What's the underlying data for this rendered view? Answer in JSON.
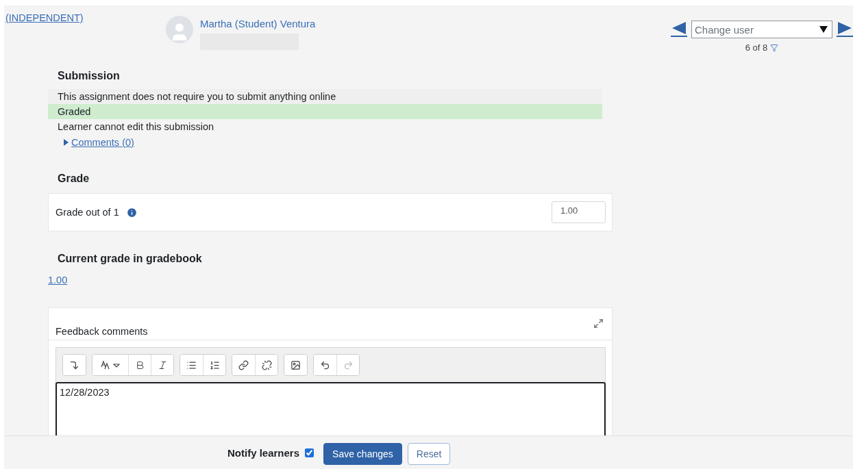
{
  "group_link": "(INDEPENDENT)",
  "user": {
    "name": "Martha (Student) Ventura"
  },
  "navigator": {
    "select": {
      "placeholder": "Change user"
    },
    "count": "6 of 8"
  },
  "submission": {
    "heading": "Submission",
    "statuses": [
      {
        "text": "This assignment does not require you to submit anything online",
        "kind": "neutral"
      },
      {
        "text": "Graded",
        "kind": "success"
      },
      {
        "text": "Learner cannot edit this submission",
        "kind": "plain"
      }
    ],
    "comments": {
      "label": "Comments (0)",
      "expanded": false
    }
  },
  "grade": {
    "heading": "Grade",
    "label": "Grade out of 1",
    "value": "1.00"
  },
  "gradebook": {
    "heading": "Current grade in gradebook",
    "value": "1.00"
  },
  "feedback": {
    "label": "Feedback comments",
    "toolbar": [
      [
        {
          "kind": "collapse",
          "disabled": false
        }
      ],
      [
        {
          "kind": "font",
          "disabled": false
        },
        {
          "kind": "bold",
          "disabled": false
        },
        {
          "kind": "italic",
          "disabled": false
        }
      ],
      [
        {
          "kind": "bullets",
          "disabled": false
        },
        {
          "kind": "numbers",
          "disabled": false
        }
      ],
      [
        {
          "kind": "link",
          "disabled": false
        },
        {
          "kind": "unlink",
          "disabled": false
        }
      ],
      [
        {
          "kind": "image",
          "disabled": false
        }
      ],
      [
        {
          "kind": "undo",
          "disabled": false
        },
        {
          "kind": "redo",
          "disabled": true
        }
      ]
    ],
    "text": "12/28/2023"
  },
  "footer": {
    "notify": {
      "label": "Notify learners",
      "checked": true
    },
    "buttons": [
      {
        "label": "Save changes",
        "kind": "primary"
      },
      {
        "label": "Reset",
        "kind": "secondary"
      }
    ]
  }
}
